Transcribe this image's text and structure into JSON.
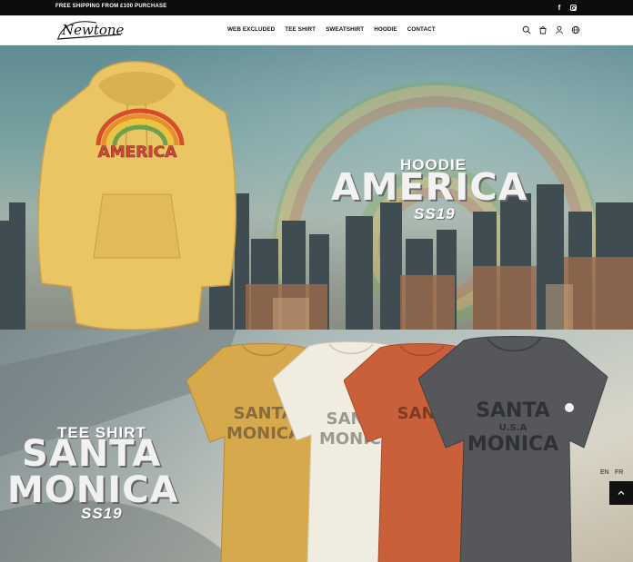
{
  "topbar": {
    "promo": "FREE SHIPPING FROM £100 PURCHASE",
    "social": [
      {
        "icon": "facebook-icon",
        "label": "f"
      },
      {
        "icon": "instagram-icon"
      }
    ]
  },
  "header": {
    "logo_text": "Newtone",
    "nav": [
      "WEB EXCLUDED",
      "TEE SHIRT",
      "SWEATSHIRT",
      "HOODIE",
      "CONTACT"
    ],
    "icons": [
      "search-icon",
      "cart-icon",
      "account-icon",
      "globe-icon"
    ]
  },
  "hero1": {
    "kicker": "HOODIE",
    "title": "AMERICA",
    "season": "SS19",
    "print_text": "AMERICA"
  },
  "hero2": {
    "kicker": "TEE SHIRT",
    "title_line1": "SANTA",
    "title_line2": "MONICA",
    "season": "SS19",
    "print_line1": "SANTA",
    "print_line2": "MONICA",
    "print_mid": "U.S.A"
  },
  "language": {
    "en": "EN",
    "fr": "FR"
  },
  "colors": {
    "hoodie": "#e9c563",
    "tee_mustard": "#d5a94c",
    "tee_white": "#f1ece0",
    "tee_rust": "#c9603a",
    "tee_charcoal": "#55575a"
  }
}
